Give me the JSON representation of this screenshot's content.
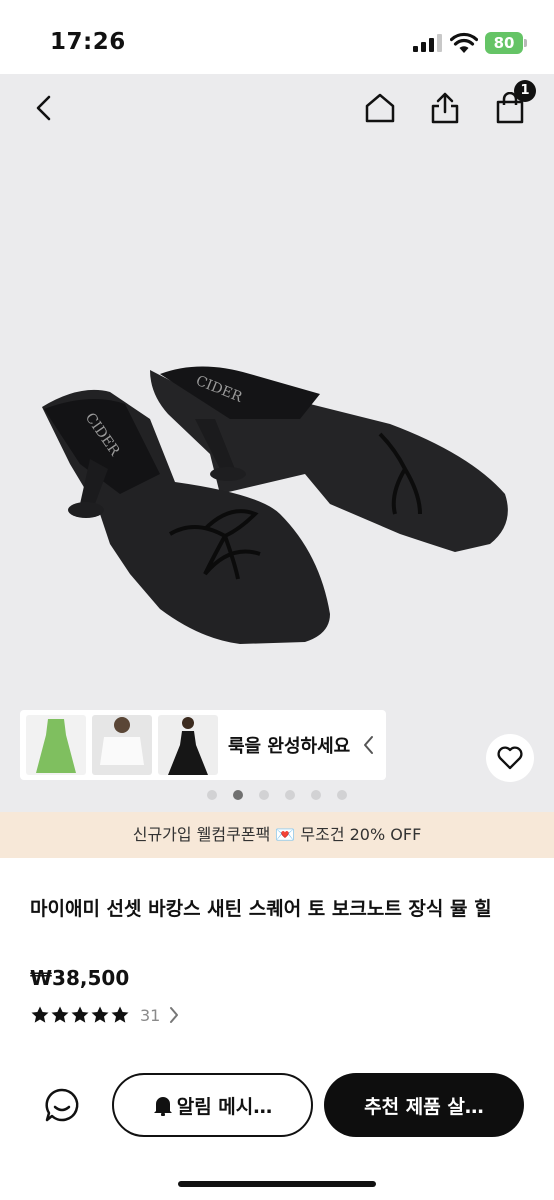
{
  "status_bar": {
    "time": "17:26",
    "battery": "80"
  },
  "header": {
    "cart_count": "1"
  },
  "look": {
    "label": "룩을 완성하세요"
  },
  "carousel": {
    "total": 6,
    "active": 1
  },
  "promo": {
    "text": "신규가입 웰컴쿠폰팩 💌 무조건 20% OFF"
  },
  "product": {
    "title": "마이애미 선셋 바캉스 새틴 스퀘어 토 보크노트 장식 뮬 힐",
    "price": "₩38,500",
    "rating": 5,
    "review_count": "31",
    "brand_mark": "CIDER"
  },
  "actions": {
    "alert_label": "알림 메시…",
    "recommend_label": "추천 제품 살…"
  },
  "colors": {
    "promo_bg": "#f7e8d8",
    "battery": "#65c466",
    "primary": "#0e0e0e"
  }
}
